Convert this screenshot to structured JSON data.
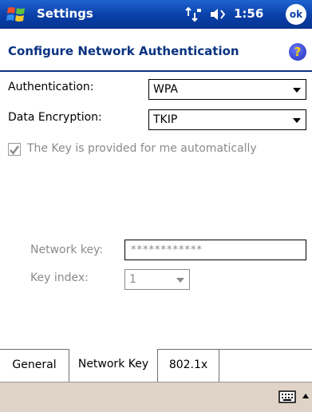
{
  "titlebar": {
    "app_title": "Settings",
    "clock": "1:56",
    "ok_label": "ok",
    "start_icon": "windows-flag-icon",
    "connectivity_icon": "connectivity-icon",
    "volume_icon": "volume-icon"
  },
  "page": {
    "title": "Configure Network Authentication",
    "help_label": "?"
  },
  "form": {
    "authentication_label": "Authentication:",
    "authentication_value": "WPA",
    "encryption_label": "Data Encryption:",
    "encryption_value": "TKIP",
    "auto_key_label": "The Key is provided for me automatically",
    "auto_key_checked": true,
    "network_key_label": "Network key:",
    "network_key_value": "************",
    "key_index_label": "Key index:",
    "key_index_value": "1"
  },
  "tabs": {
    "general": "General",
    "network_key": "Network Key",
    "dot1x": "802.1x",
    "active": "network_key"
  },
  "bottombar": {
    "keyboard_icon": "keyboard-icon"
  },
  "colors": {
    "titlebar_blue": "#0a3fa8",
    "header_text": "#0a3380",
    "disabled_text": "#8a8a8a",
    "command_bar": "#ded3c6"
  }
}
